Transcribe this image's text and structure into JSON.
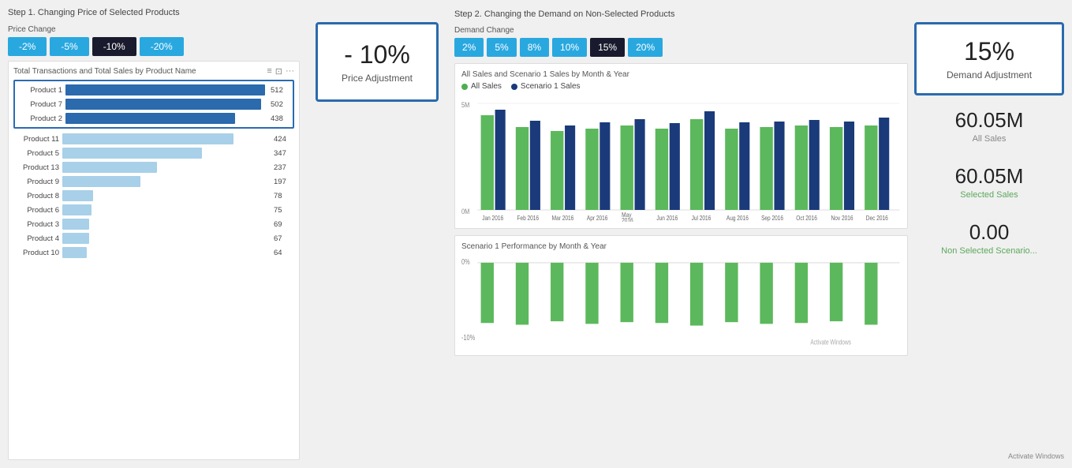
{
  "steps": {
    "step1_title": "Step 1. Changing Price of Selected Products",
    "step2_title": "Step 2. Changing the Demand on Non-Selected Products"
  },
  "priceChange": {
    "label": "Price Change",
    "buttons": [
      "-2%",
      "-5%",
      "-10%",
      "-20%"
    ],
    "active": "-10%"
  },
  "priceAdjustment": {
    "value": "- 10%",
    "label": "Price Adjustment"
  },
  "demandChange": {
    "label": "Demand Change",
    "buttons": [
      "2%",
      "5%",
      "8%",
      "10%",
      "15%",
      "20%"
    ],
    "active": "15%"
  },
  "demandAdjustment": {
    "value": "15%",
    "label": "Demand Adjustment"
  },
  "barChart": {
    "title": "Total Transactions and Total Sales by Product Name",
    "products": [
      {
        "name": "Product 1",
        "value": 512,
        "pct": 100,
        "type": "highlighted"
      },
      {
        "name": "Product 7",
        "value": 502,
        "pct": 98,
        "type": "highlighted"
      },
      {
        "name": "Product 2",
        "value": 438,
        "pct": 85,
        "type": "highlighted"
      },
      {
        "name": "Product 11",
        "value": 424,
        "pct": 83,
        "type": "normal"
      },
      {
        "name": "Product 5",
        "value": 347,
        "pct": 68,
        "type": "normal"
      },
      {
        "name": "Product 13",
        "value": 237,
        "pct": 46,
        "type": "normal"
      },
      {
        "name": "Product 9",
        "value": 197,
        "pct": 38,
        "type": "normal"
      },
      {
        "name": "Product 8",
        "value": 78,
        "pct": 15,
        "type": "normal"
      },
      {
        "name": "Product 6",
        "value": 75,
        "pct": 14,
        "type": "normal"
      },
      {
        "name": "Product 3",
        "value": 69,
        "pct": 13,
        "type": "normal"
      },
      {
        "name": "Product 4",
        "value": 67,
        "pct": 13,
        "type": "normal"
      },
      {
        "name": "Product 10",
        "value": 64,
        "pct": 12,
        "type": "normal"
      }
    ]
  },
  "salesChart": {
    "title": "All Sales and Scenario 1 Sales by Month & Year",
    "legend": [
      "All Sales",
      "Scenario 1 Sales"
    ],
    "months": [
      "Jan 2016",
      "Feb 2016",
      "Mar 2016",
      "Apr 2016",
      "May 2016",
      "Jun 2016",
      "Jul 2016",
      "Aug 2016",
      "Sep 2016",
      "Oct 2016",
      "Nov 2016",
      "Dec 2016"
    ],
    "yLabel": "5M",
    "yLabelBottom": "0M"
  },
  "scenarioChart": {
    "title": "Scenario 1 Performance by Month & Year",
    "yLabel": "0%",
    "yLabelBottom": "-10%"
  },
  "stats": {
    "allSales": {
      "value": "60.05M",
      "label": "All Sales"
    },
    "selectedSales": {
      "value": "60.05M",
      "label": "Selected Sales"
    },
    "nonSelected": {
      "value": "0.00",
      "label": "Non Selected Scenario..."
    }
  },
  "activateWindows": "Activate Windows"
}
